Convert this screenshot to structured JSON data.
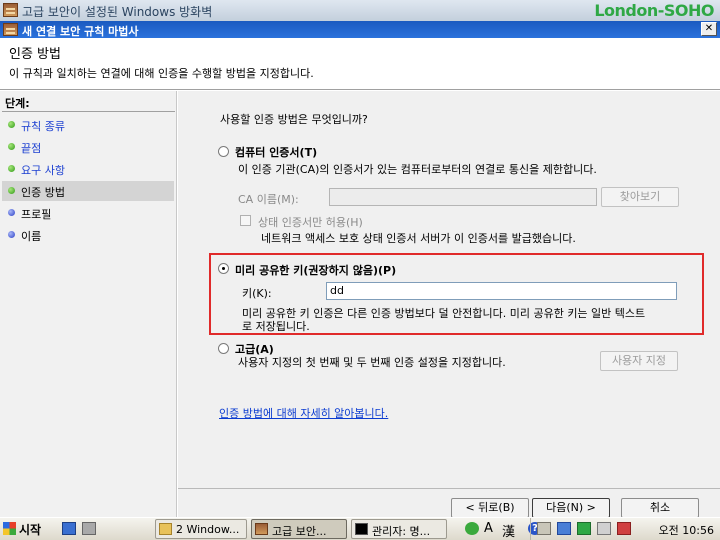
{
  "parent_window": {
    "title": "고급 보안이 설정된 Windows 방화벽",
    "watermark": "London-SOHO"
  },
  "wizard": {
    "title": "새 연결 보안 규칙 마법사",
    "close_glyph": "✕",
    "header_title": "인증 방법",
    "header_subtitle": "이 규칙과 일치하는 연결에 대해 인증을 수행할 방법을 지정합니다."
  },
  "steps": {
    "heading": "단계:",
    "items": [
      {
        "label": "규칙 종류",
        "dot": "green",
        "link": true
      },
      {
        "label": "끝점",
        "dot": "green",
        "link": true
      },
      {
        "label": "요구 사항",
        "dot": "green",
        "link": true
      },
      {
        "label": "인증 방법",
        "dot": "green",
        "link": false,
        "active": true
      },
      {
        "label": "프로필",
        "dot": "blue",
        "link": false
      },
      {
        "label": "이름",
        "dot": "blue",
        "link": false
      }
    ]
  },
  "content": {
    "question": "사용할 인증 방법은 무엇입니까?",
    "computer_cert": {
      "label": "컴퓨터 인증서(T)",
      "desc": "이 인증 기관(CA)의 인증서가 있는 컴퓨터로부터의 연결로 통신을 제한합니다.",
      "ca_label": "CA 이름(M):",
      "ca_value": "",
      "browse_label": "찾아보기",
      "health_label": "상태 인증서만 허용(H)",
      "health_desc": "네트워크 액세스 보호 상태 인증서 서버가 이 인증서를 발급했습니다."
    },
    "preshared": {
      "label": "미리 공유한 키(권장하지 않음)(P)",
      "key_label": "키(K):",
      "key_value": "dd",
      "desc_line1": "미리 공유한 키 인증은 다른 인증 방법보다 덜 안전합니다. 미리 공유한 키는 일반 텍스트",
      "desc_line2": "로 저장됩니다."
    },
    "advanced": {
      "label": "고급(A)",
      "desc": "사용자 지정의 첫 번째 및 두 번째 인증 설정을 지정합니다.",
      "custom_label": "사용자 지정"
    },
    "learn_more": "인증 방법에 대해 자세히 알아봅니다."
  },
  "footer": {
    "back": "< 뒤로(B)",
    "next": "다음(N) >",
    "cancel": "취소"
  },
  "taskbar": {
    "start": "시작",
    "items": [
      {
        "label": "2 Window...",
        "icon": "folder-icon"
      },
      {
        "label": "고급 보안...",
        "icon": "firewall-icon",
        "active": true
      },
      {
        "label": "관리자: 명...",
        "icon": "cmd-icon"
      }
    ],
    "ime": [
      "A",
      "漢"
    ],
    "clock": "오전 10:56"
  },
  "colors": {
    "title_blue": "#1a5ac0",
    "highlight_red": "#e02a2a",
    "link_blue": "#1b3fd1",
    "step_green": "#2f9a16",
    "step_blue": "#2a3fc6"
  }
}
